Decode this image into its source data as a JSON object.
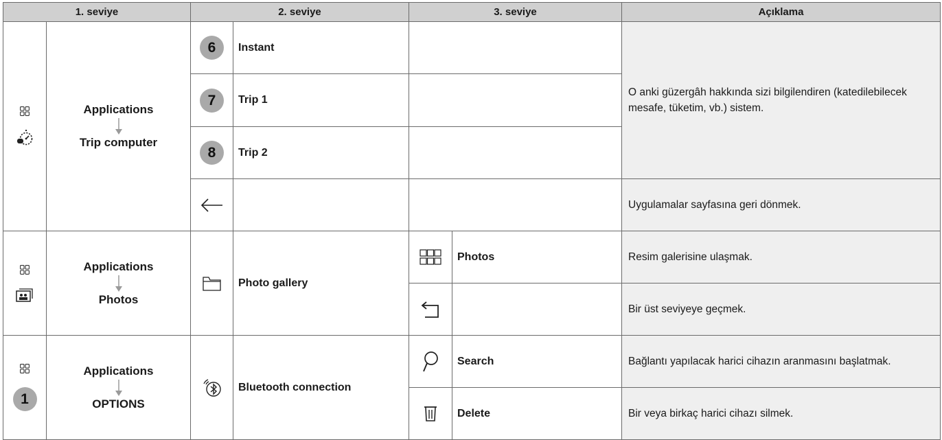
{
  "headers": {
    "level1": "1. seviye",
    "level2": "2. seviye",
    "level3": "3. seviye",
    "description": "Açıklama"
  },
  "trip": {
    "level1_top": "Applications",
    "level1_bottom": "Trip computer",
    "items": [
      {
        "number": "6",
        "label": "Instant"
      },
      {
        "number": "7",
        "label": "Trip 1"
      },
      {
        "number": "8",
        "label": "Trip 2"
      }
    ],
    "info_description": "O anki güzergâh hakkında sizi bilgilendiren (katedilebilecek mesafe, tüketim, vb.) sistem.",
    "back_description": "Uygulamalar sayfasına geri dönmek."
  },
  "photos": {
    "level1_top": "Applications",
    "level1_bottom": "Photos",
    "level2_label": "Photo gallery",
    "photos_label": "Photos",
    "photos_description": "Resim galerisine ulaşmak.",
    "up_description": "Bir üst seviyeye geçmek."
  },
  "options": {
    "level1_top": "Applications",
    "level1_bottom": "OPTIONS",
    "badge_number": "1",
    "level2_label": "Bluetooth connection",
    "search_label": "Search",
    "search_description": "Bağlantı yapılacak harici cihazın aranmasını başlatmak.",
    "delete_label": "Delete",
    "delete_description": "Bir veya birkaç harici cihazı silmek."
  },
  "icons": {
    "apps": "apps-grid-icon",
    "trip_computer": "trip-computer-icon",
    "back_arrow": "back-arrow-icon",
    "photos_app": "photos-app-icon",
    "folder": "folder-icon",
    "grid_view": "grid-view-icon",
    "return": "return-up-icon",
    "bluetooth": "bluetooth-icon",
    "search": "search-icon",
    "delete": "trash-icon"
  }
}
